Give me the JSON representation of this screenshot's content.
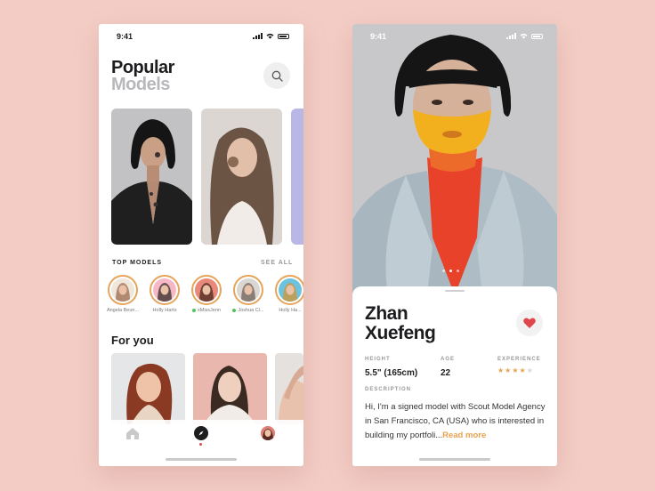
{
  "left_screen": {
    "status": {
      "time": "9:41"
    },
    "title_line1": "Popular",
    "title_line2": "Models",
    "top_models": {
      "heading": "TOP MODELS",
      "see_all": "SEE ALL",
      "models": [
        {
          "name": "Angela Beun...",
          "online": false,
          "bg": "#f0e7dc",
          "face": "#a5785d"
        },
        {
          "name": "Holly Harts",
          "online": false,
          "bg": "#f6b8c6",
          "face": "#4a3a38"
        },
        {
          "name": "xMissJenn",
          "online": true,
          "bg": "#e8897a",
          "face": "#5a3228"
        },
        {
          "name": "Joshua Cl...",
          "online": true,
          "bg": "#d9d6d3",
          "face": "#7c6f66"
        },
        {
          "name": "Holly Ha...",
          "online": false,
          "bg": "#6cc3e0",
          "face": "#c99a45"
        }
      ]
    },
    "for_you_heading": "For you"
  },
  "right_screen": {
    "status": {
      "time": "9:41"
    },
    "model_name_line1": "Zhan",
    "model_name_line2": "Xuefeng",
    "stats": {
      "height_label": "HEIGHT",
      "height_value": "5.5\" (165cm)",
      "age_label": "AGE",
      "age_value": "22",
      "experience_label": "EXPERIENCE",
      "experience_stars": 4,
      "experience_max": 5
    },
    "description_label": "DESCRIPTION",
    "description": "Hi, I'm a signed model with Scout Model Agency in San Francisco, CA (USA) who is interested in building my portfoli...",
    "read_more": "Read more",
    "carousel": {
      "pages": 3,
      "active": 2
    }
  },
  "colors": {
    "background": "#f3cdc5",
    "accent": "#e8a04f",
    "heart": "#e0474c",
    "online": "#52c35d"
  },
  "icons": [
    "search-icon",
    "home-icon",
    "compass-icon",
    "heart-icon",
    "star-icon"
  ]
}
